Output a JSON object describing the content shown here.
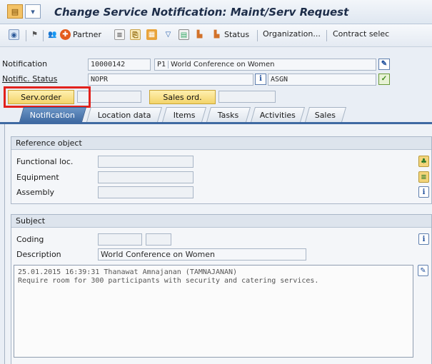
{
  "title": "Change Service Notification: Maint/Serv Request",
  "toolbar": {
    "partner": "Partner",
    "status": "Status",
    "organization": "Organization...",
    "contract": "Contract selec"
  },
  "header": {
    "notification_label": "Notification",
    "notification_number": "10000142",
    "notification_type": "P1",
    "notification_desc": "World Conference on Women",
    "status_label": "Notific. Status",
    "status_value": "NOPR",
    "status_user": "ASGN",
    "serv_order_button": "Serv.order",
    "sales_order_button": "Sales ord."
  },
  "tabs": [
    {
      "label": "Notification",
      "active": true
    },
    {
      "label": "Location data",
      "active": false
    },
    {
      "label": "Items",
      "active": false
    },
    {
      "label": "Tasks",
      "active": false
    },
    {
      "label": "Activities",
      "active": false
    },
    {
      "label": "Sales",
      "active": false
    }
  ],
  "reference_object": {
    "title": "Reference object",
    "functional_loc": "Functional loc.",
    "equipment": "Equipment",
    "assembly": "Assembly"
  },
  "subject": {
    "title": "Subject",
    "coding_label": "Coding",
    "description_label": "Description",
    "description_value": "World Conference on Women",
    "text_lines": [
      "25.01.2015 16:39:31 Thanawat Amnajanan (TAMNAJANAN)",
      "Require room for 300 participants with security and catering services."
    ]
  },
  "colors": {
    "tab_active": "#3f6aa2",
    "highlight": "#e2211c",
    "button_yellow": "#f3d46a"
  }
}
